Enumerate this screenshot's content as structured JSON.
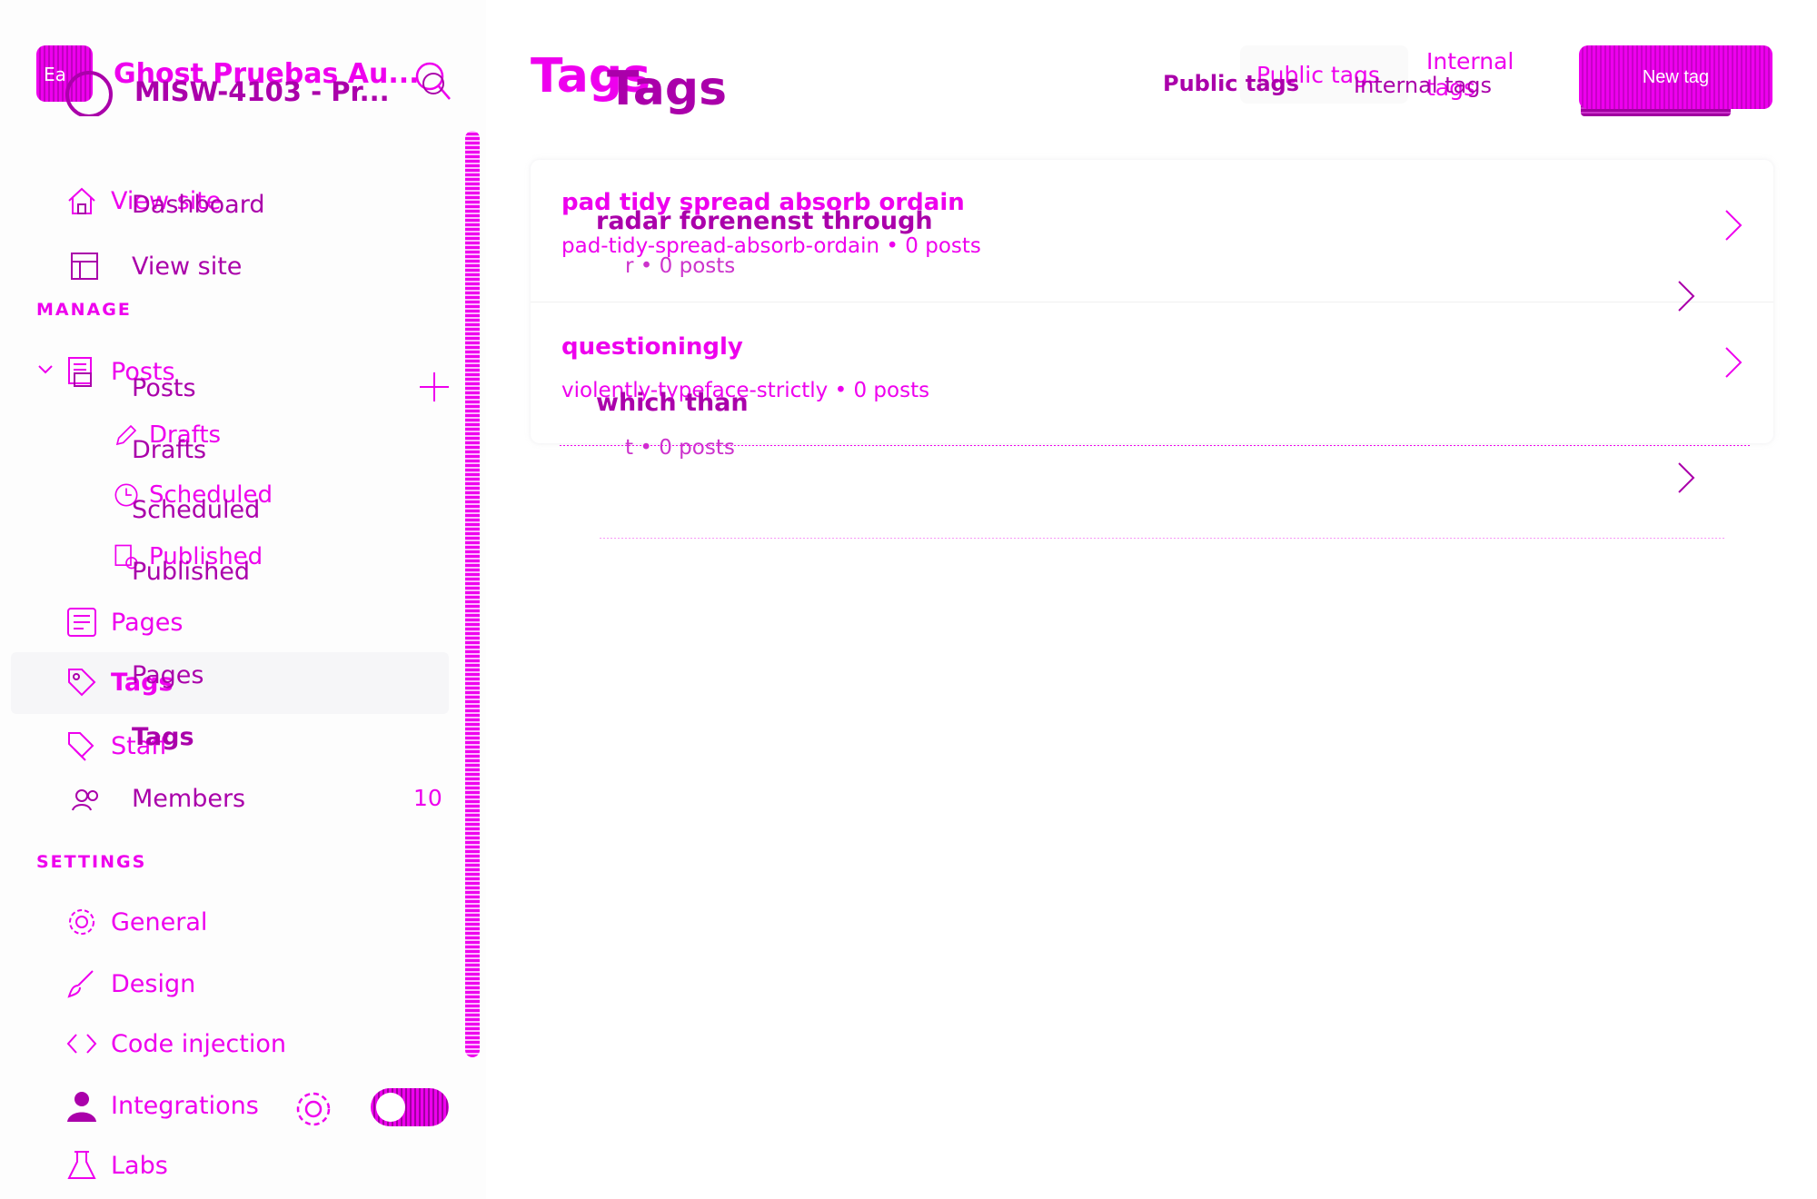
{
  "sidebar": {
    "site_title": "Ghost Pruebas Au...",
    "logo_initials": "Ea",
    "nav_top": [
      {
        "label": "View site",
        "icon": "home-icon"
      }
    ],
    "manage_title": "MANAGE",
    "manage_items": [
      {
        "label": "Posts",
        "icon": "posts-icon"
      },
      {
        "label": "Drafts",
        "icon": "pencil-icon"
      },
      {
        "label": "Scheduled",
        "icon": "clock-icon"
      },
      {
        "label": "Published",
        "icon": "published-icon"
      },
      {
        "label": "Pages",
        "icon": "pages-icon"
      },
      {
        "label": "Tags",
        "icon": "tag-icon"
      },
      {
        "label": "Staff",
        "icon": "staff-icon"
      }
    ],
    "settings_title": "SETTINGS",
    "settings_items": [
      {
        "label": "General",
        "icon": "gear-icon"
      },
      {
        "label": "Design",
        "icon": "brush-icon"
      },
      {
        "label": "Code injection",
        "icon": "code-icon"
      },
      {
        "label": "Integrations",
        "icon": "integrations-icon"
      },
      {
        "label": "Labs",
        "icon": "flask-icon"
      }
    ]
  },
  "sidebar_ghost": {
    "site_title": "MISW-4103 - Pr...",
    "items": {
      "dashboard": "Dashboard",
      "view_site": "View site",
      "posts": "Posts",
      "drafts": "Drafts",
      "scheduled": "Scheduled",
      "published": "Published",
      "pages": "Pages",
      "tags": "Tags",
      "members": "Members",
      "members_count": "10"
    }
  },
  "main": {
    "title": "Tags",
    "segments": {
      "public": "Public tags",
      "internal": "Internal tags"
    },
    "new_tag_label": "New tag",
    "tags": [
      {
        "name": "pad tidy spread absorb ordain",
        "meta": "pad-tidy-spread-absorb-ordain • 0 posts"
      },
      {
        "name": "questioningly",
        "meta": "violently-typeface-strictly • 0 posts"
      }
    ]
  },
  "main_ghost": {
    "title": "Tags",
    "segments": {
      "public": "Public tags",
      "internal": "Internal tags"
    },
    "tags": [
      {
        "name": "radar forenenst through",
        "meta": "r • 0 posts"
      },
      {
        "name": "which than",
        "meta": "t • 0 posts"
      }
    ]
  },
  "colors": {
    "accent": "#ee00ee",
    "accent_dark": "#aa00aa",
    "background": "#ffffff"
  }
}
